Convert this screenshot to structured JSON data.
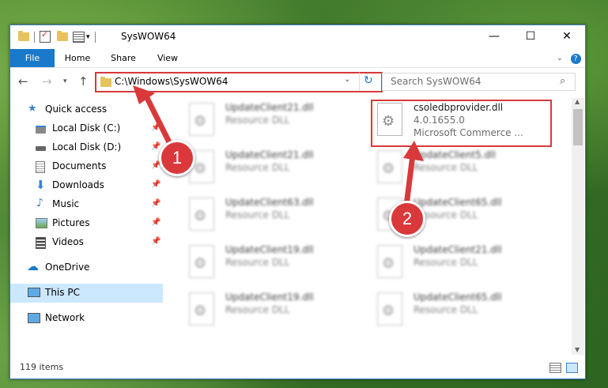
{
  "window": {
    "title": "SysWOW64"
  },
  "ribbon": {
    "tabs": [
      "File",
      "Home",
      "Share",
      "View"
    ]
  },
  "address": {
    "path": "C:\\Windows\\SysWOW64"
  },
  "search": {
    "placeholder": "Search SysWOW64"
  },
  "sidebar": {
    "items": [
      {
        "label": "Quick access",
        "icon": "star-icon"
      },
      {
        "label": "Local Disk (C:)",
        "icon": "drive-icon",
        "pinned": true
      },
      {
        "label": "Local Disk (D:)",
        "icon": "drive-icon",
        "pinned": true
      },
      {
        "label": "Documents",
        "icon": "documents-icon",
        "pinned": true
      },
      {
        "label": "Downloads",
        "icon": "downloads-icon",
        "pinned": true
      },
      {
        "label": "Music",
        "icon": "music-icon",
        "pinned": true
      },
      {
        "label": "Pictures",
        "icon": "pictures-icon",
        "pinned": true
      },
      {
        "label": "Videos",
        "icon": "videos-icon",
        "pinned": true
      },
      {
        "label": "OneDrive",
        "icon": "onedrive-icon"
      },
      {
        "label": "This PC",
        "icon": "pc-icon",
        "selected": true
      },
      {
        "label": "Network",
        "icon": "network-icon"
      }
    ]
  },
  "files": {
    "left": [
      {
        "name": "UpdateClient21.dll",
        "type": "Resource DLL"
      },
      {
        "name": "UpdateClient21.dll",
        "type": "Resource DLL"
      },
      {
        "name": "UpdateClient63.dll",
        "type": "Resource DLL"
      },
      {
        "name": "UpdateClient19.dll",
        "type": "Resource DLL"
      },
      {
        "name": "UpdateClient19.dll",
        "type": "Resource DLL"
      }
    ],
    "highlighted": {
      "name": "csoledbprovider.dll",
      "version": "4.0.1655.0",
      "company": "Microsoft Commerce ..."
    },
    "right": [
      {
        "name": "UpdateClient5.dll",
        "type": "Resource DLL"
      },
      {
        "name": "UpdateClient65.dll",
        "type": "Resource DLL"
      },
      {
        "name": "UpdateClient21.dll",
        "type": "Resource DLL"
      },
      {
        "name": "UpdateClient65.dll",
        "type": "Resource DLL"
      }
    ]
  },
  "status": {
    "count": "119 items"
  },
  "annotations": {
    "step1": "1",
    "step2": "2"
  }
}
